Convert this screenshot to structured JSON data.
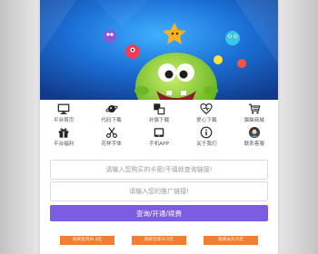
{
  "menu": {
    "row1": [
      {
        "label": "平台首页",
        "icon": "monitor-icon"
      },
      {
        "label": "代码下载",
        "icon": "planet-icon"
      },
      {
        "label": "补偿下载",
        "icon": "windows-squares-icon"
      },
      {
        "label": "爱心下载",
        "icon": "heart-icon"
      },
      {
        "label": "猫猫商城",
        "icon": "cart-icon"
      }
    ],
    "row2": [
      {
        "label": "平台福利",
        "icon": "gift-icon"
      },
      {
        "label": "花样字体",
        "icon": "scissors-icon"
      },
      {
        "label": "手机APP",
        "icon": "tablet-icon"
      },
      {
        "label": "关于我们",
        "icon": "info-icon"
      },
      {
        "label": "联系客服",
        "icon": "headset-avatar-icon"
      }
    ]
  },
  "form": {
    "card_placeholder": "请输入您购买的卡密/不填就查询链接!",
    "link_placeholder": "请输入您的推广链接!",
    "submit_label": "查询/开通/续费"
  },
  "buy": [
    {
      "label": "购买包月/0.3元"
    },
    {
      "label": "购买包年/2.5元"
    },
    {
      "label": "购买永久/5元"
    }
  ],
  "colors": {
    "accent": "#7c5ce0",
    "buy": "#f07f34",
    "banner_bg": "#1b6fd6"
  }
}
